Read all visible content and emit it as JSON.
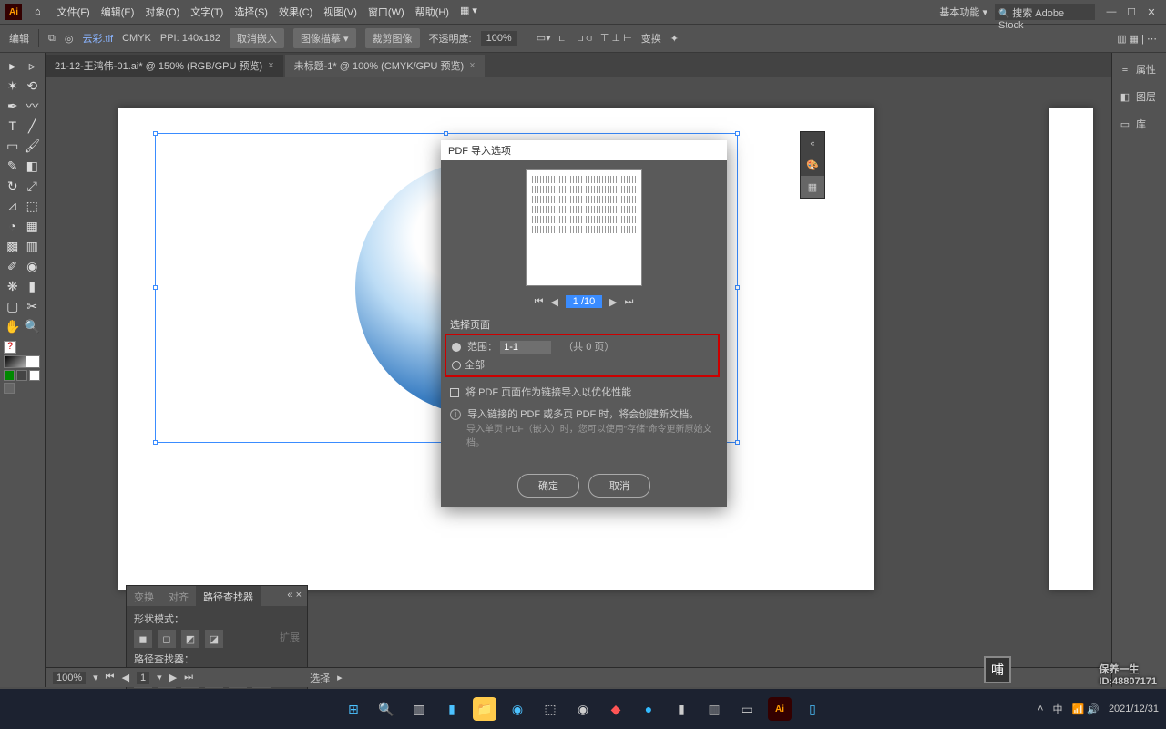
{
  "menubar": {
    "items": [
      "文件(F)",
      "编辑(E)",
      "对象(O)",
      "文字(T)",
      "选择(S)",
      "效果(C)",
      "视图(V)",
      "窗口(W)",
      "帮助(H)"
    ]
  },
  "titlebar": {
    "workspace": "基本功能",
    "search_placeholder": "搜索 Adobe Stock"
  },
  "optbar": {
    "mode": "编辑",
    "link": "云彩.tif",
    "colormode": "CMYK",
    "ppi": "PPI: 140x162",
    "cancel": "取消嵌入",
    "placeopt": "图像描摹",
    "crop": "裁剪图像",
    "opacity_lbl": "不透明度:",
    "opacity": "100%",
    "transform": "变换"
  },
  "tabs": [
    {
      "label": "21-12-王鸿伟-01.ai* @ 150% (RGB/GPU 预览)",
      "active": false
    },
    {
      "label": "未标题-1* @ 100% (CMYK/GPU 预览)",
      "active": true
    }
  ],
  "rightdock": [
    {
      "icon": "≡",
      "label": "属性"
    },
    {
      "icon": "◧",
      "label": "图层"
    },
    {
      "icon": "▭",
      "label": "库"
    }
  ],
  "pathfinder": {
    "tabs": [
      "变换",
      "对齐",
      "路径查找器"
    ],
    "active": 2,
    "shape_lbl": "形状模式：",
    "pf_lbl": "路径查找器：",
    "expand": "扩展"
  },
  "dialog": {
    "title": "PDF 导入选项",
    "page_current": "1 /10",
    "section_lbl": "选择页面",
    "range_lbl": "范围：",
    "range_val": "1-1",
    "range_suffix": "（共   0 页）",
    "all_lbl": "全部",
    "link_chk": "将 PDF 页面作为链接导入以优化性能",
    "info1": "导入链接的 PDF 或多页 PDF 时，将会创建新文档。",
    "info2": "导入单页 PDF（嵌入）时，您可以使用“存储”命令更新原始文档。",
    "ok": "确定",
    "cancel": "取消"
  },
  "status": {
    "zoom": "100%",
    "page": "1",
    "mode": "选择"
  },
  "watermark": {
    "brand": "保养一生",
    "id": "ID:48807171",
    "date": "2021/12/31"
  }
}
